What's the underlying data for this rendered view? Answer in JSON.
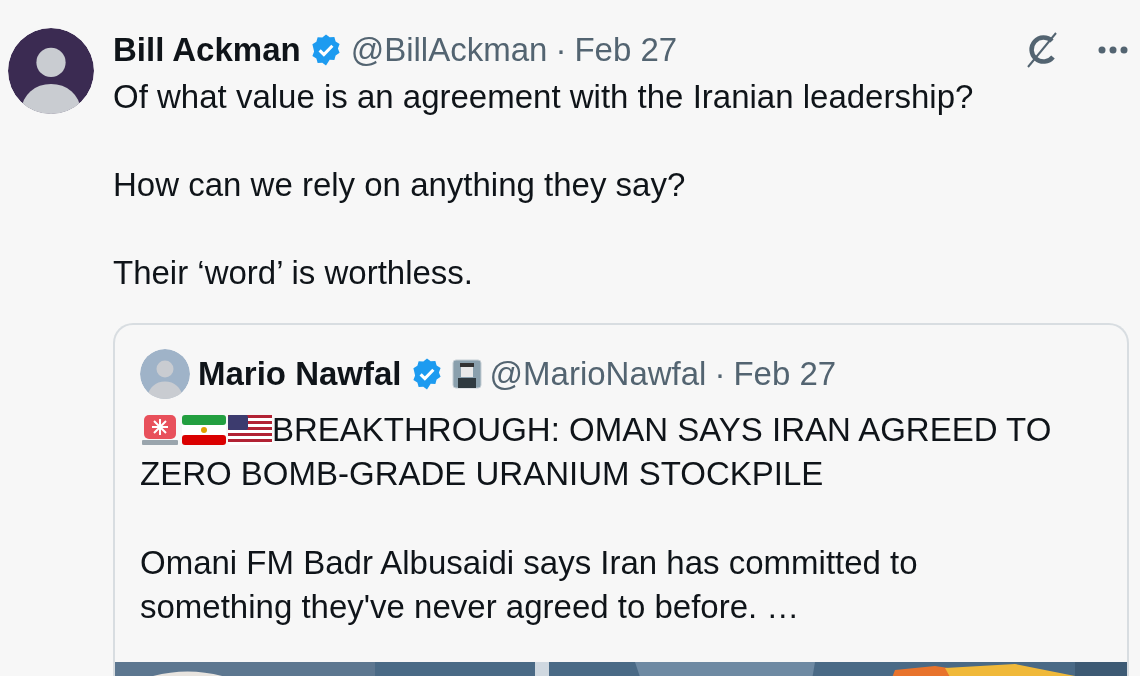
{
  "tweet": {
    "author": {
      "name": "Bill Ackman",
      "verified": true,
      "handle": "@BillAckman",
      "separator": "·",
      "date": "Feb 27"
    },
    "paragraphs": [
      "Of what value is an agreement with the Iranian leadership?",
      "How can we rely on anything they say?",
      "Their ‘word’ is worthless."
    ],
    "quote": {
      "author": {
        "name": "Mario Nawfal",
        "verified": true,
        "handle": "@MarioNawfal",
        "separator": "·",
        "date": "Feb 27"
      },
      "paragraphs": [
        {
          "icons": [
            {
              "kind": "siren"
            },
            {
              "kind": "iran-flag"
            },
            {
              "kind": "us-flag"
            }
          ],
          "lines": [
            "BREAKTHROUGH: OMAN SAYS IRAN AGREED TO",
            "ZERO BOMB-GRADE URANIUM STOCKPILE"
          ]
        },
        {
          "lines": [
            "Omani FM Badr Albusaidi says Iran has committed to",
            "something they've never agreed to before. …"
          ]
        }
      ]
    }
  }
}
